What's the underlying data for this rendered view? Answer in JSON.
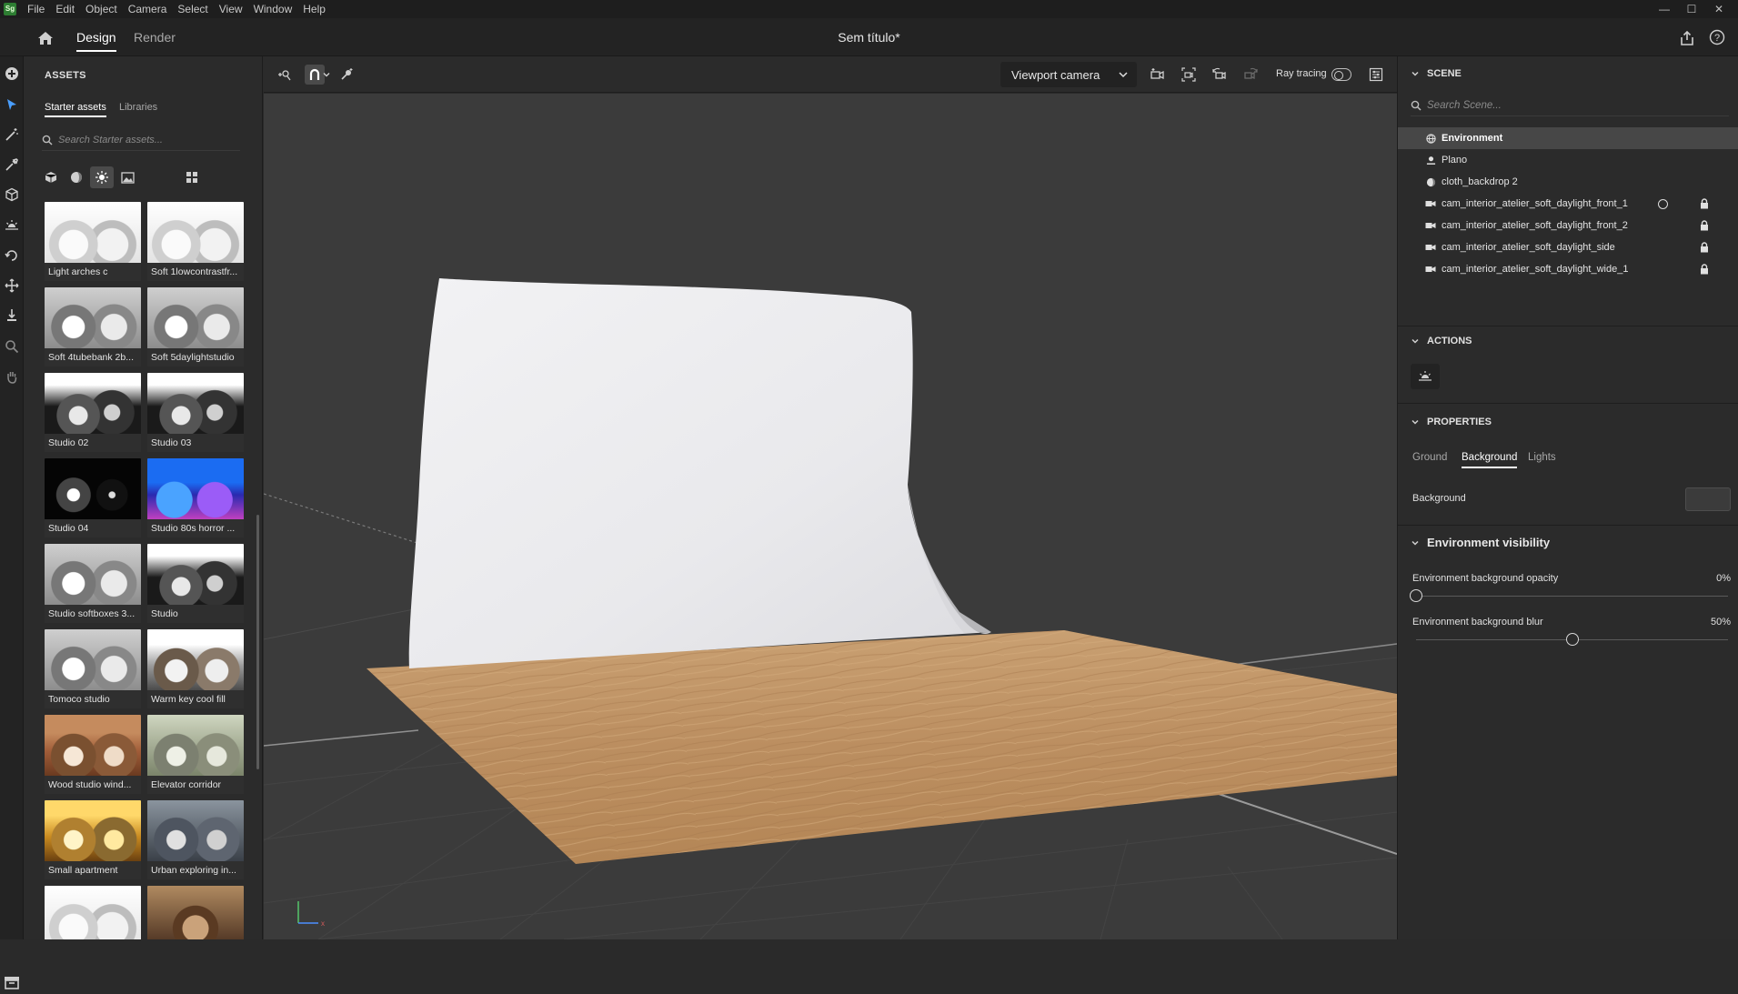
{
  "app": {
    "logo_text": "Sg",
    "title": "Sem título*"
  },
  "menu": [
    "File",
    "Edit",
    "Object",
    "Camera",
    "Select",
    "View",
    "Window",
    "Help"
  ],
  "window_controls": {
    "minimize": "—",
    "maximize": "☐",
    "close": "✕"
  },
  "topnav": {
    "tabs": [
      "Design",
      "Render"
    ],
    "active_tab": "Design"
  },
  "assets": {
    "title": "ASSETS",
    "subtabs": [
      "Starter assets",
      "Libraries"
    ],
    "active_subtab": "Starter assets",
    "search_placeholder": "Search Starter assets...",
    "filters": [
      "models-icon",
      "materials-icon",
      "lights-icon",
      "images-icon"
    ],
    "active_filter": "lights-icon",
    "view_toggle": "grid-view-icon",
    "items": [
      {
        "label": "Light arches c",
        "tone": "bright"
      },
      {
        "label": "Soft 1lowcontrastfr...",
        "tone": "bright"
      },
      {
        "label": "Soft 4tubebank 2b...",
        "tone": "gray"
      },
      {
        "label": "Soft 5daylightstudio",
        "tone": "gray"
      },
      {
        "label": "Studio 02",
        "tone": "dark"
      },
      {
        "label": "Studio 03",
        "tone": "dark"
      },
      {
        "label": "Studio 04",
        "tone": "black"
      },
      {
        "label": "Studio 80s horror ...",
        "tone": "neon"
      },
      {
        "label": "Studio softboxes 3...",
        "tone": "gray"
      },
      {
        "label": "Studio",
        "tone": "dark"
      },
      {
        "label": "Tomoco studio",
        "tone": "gray"
      },
      {
        "label": "Warm key cool fill",
        "tone": "warm"
      },
      {
        "label": "Wood studio wind...",
        "tone": "wood"
      },
      {
        "label": "Elevator corridor",
        "tone": "olive"
      },
      {
        "label": "Small apartment",
        "tone": "amber"
      },
      {
        "label": "Urban exploring in...",
        "tone": "urban"
      },
      {
        "label": "",
        "tone": "bright"
      },
      {
        "label": "",
        "tone": "brown"
      }
    ]
  },
  "viewport_toolbar": {
    "camera": "Viewport camera",
    "ray_tracing_label": "Ray tracing",
    "ray_tracing_on": false
  },
  "scene": {
    "title": "SCENE",
    "search_placeholder": "Search Scene...",
    "items": [
      {
        "label": "Environment",
        "icon": "environment-icon",
        "selected": true,
        "circle": false,
        "locked": false
      },
      {
        "label": "Plano",
        "icon": "plane-object-icon",
        "selected": false,
        "circle": false,
        "locked": false
      },
      {
        "label": "cloth_backdrop 2",
        "icon": "object-icon",
        "selected": false,
        "circle": false,
        "locked": false
      },
      {
        "label": "cam_interior_atelier_soft_daylight_front_1",
        "icon": "camera-icon",
        "selected": false,
        "circle": true,
        "locked": true
      },
      {
        "label": "cam_interior_atelier_soft_daylight_front_2",
        "icon": "camera-icon",
        "selected": false,
        "circle": false,
        "locked": true
      },
      {
        "label": "cam_interior_atelier_soft_daylight_side",
        "icon": "camera-icon",
        "selected": false,
        "circle": false,
        "locked": true
      },
      {
        "label": "cam_interior_atelier_soft_daylight_wide_1",
        "icon": "camera-icon",
        "selected": false,
        "circle": false,
        "locked": true
      }
    ]
  },
  "actions": {
    "title": "ACTIONS"
  },
  "properties": {
    "title": "PROPERTIES",
    "tabs": [
      "Ground",
      "Background",
      "Lights"
    ],
    "active_tab": "Background",
    "background_label": "Background",
    "background_color": "#3b3b3b",
    "env_visibility_title": "Environment visibility",
    "opacity_label": "Environment background opacity",
    "opacity_value": "0%",
    "opacity_fraction": 0,
    "blur_label": "Environment background blur",
    "blur_value": "50%",
    "blur_fraction": 0.5
  },
  "colors": {
    "accent": "#ffffff",
    "panel": "#2b2b2b",
    "viewport": "#3b3b3b",
    "wood": "#c19668"
  }
}
